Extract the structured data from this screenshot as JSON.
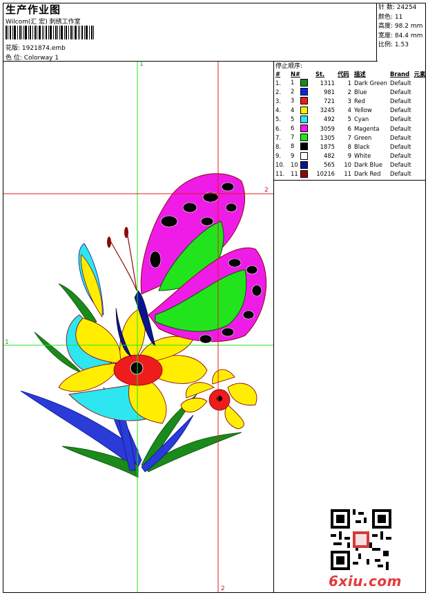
{
  "header": {
    "title": "生产作业图",
    "company": "Wilcom(汇 宏) 刺绣工作室",
    "design_label": "花版:",
    "design_file": "1921874.emb",
    "colorway_label": "色 位:",
    "colorway": "Colorway 1"
  },
  "stats": {
    "stitches_label": "针 数:",
    "stitches": "24254",
    "colors_label": "颜色:",
    "colors": "11",
    "height_label": "高度:",
    "height": "98.2 mm",
    "width_label": "宽度:",
    "width": "84.4 mm",
    "ratio_label": "比例:",
    "ratio": "1.53"
  },
  "stop_sequence": {
    "title": "停止顺序:",
    "columns": [
      "#",
      "N#",
      "St.",
      "代码",
      "描述",
      "Brand",
      "元素"
    ],
    "rows": [
      {
        "idx": "1.",
        "n": "1",
        "st": "1311",
        "code": "1",
        "desc": "Dark Green",
        "brand": "Default",
        "color": "#1a8a1a"
      },
      {
        "idx": "2.",
        "n": "2",
        "st": "981",
        "code": "2",
        "desc": "Blue",
        "brand": "Default",
        "color": "#0028e6"
      },
      {
        "idx": "3.",
        "n": "3",
        "st": "721",
        "code": "3",
        "desc": "Red",
        "brand": "Default",
        "color": "#ee1c1c"
      },
      {
        "idx": "4.",
        "n": "4",
        "st": "3245",
        "code": "4",
        "desc": "Yellow",
        "brand": "Default",
        "color": "#ffee00"
      },
      {
        "idx": "5.",
        "n": "5",
        "st": "492",
        "code": "5",
        "desc": "Cyan",
        "brand": "Default",
        "color": "#2ee6f0"
      },
      {
        "idx": "6.",
        "n": "6",
        "st": "3059",
        "code": "6",
        "desc": "Magenta",
        "brand": "Default",
        "color": "#ee1ce6"
      },
      {
        "idx": "7.",
        "n": "7",
        "st": "1305",
        "code": "7",
        "desc": "Green",
        "brand": "Default",
        "color": "#22e41c"
      },
      {
        "idx": "8.",
        "n": "8",
        "st": "1875",
        "code": "8",
        "desc": "Black",
        "brand": "Default",
        "color": "#000000"
      },
      {
        "idx": "9.",
        "n": "9",
        "st": "482",
        "code": "9",
        "desc": "White",
        "brand": "Default",
        "color": "#ffffff"
      },
      {
        "idx": "10.",
        "n": "10",
        "st": "565",
        "code": "10",
        "desc": "Dark Blue",
        "brand": "Default",
        "color": "#0a1490"
      },
      {
        "idx": "11.",
        "n": "11",
        "st": "10216",
        "code": "11",
        "desc": "Dark Red",
        "brand": "Default",
        "color": "#8a0a0a"
      }
    ]
  },
  "crosshair_labels": {
    "green_top": "1",
    "green_left": "1",
    "red_right": "2",
    "red_bottom": "2"
  },
  "watermark": "6xiu.com"
}
